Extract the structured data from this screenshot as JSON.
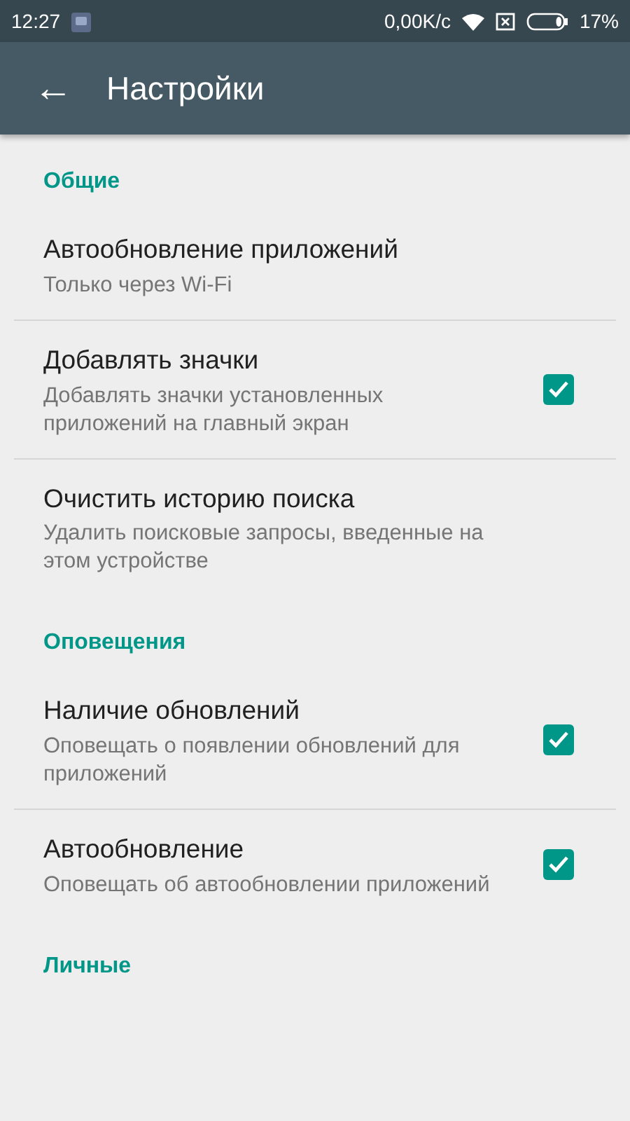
{
  "status_bar": {
    "time": "12:27",
    "speed": "0,00K/c",
    "battery": "17%"
  },
  "toolbar": {
    "back": "←",
    "title": "Настройки"
  },
  "sections": [
    {
      "title": "Общие",
      "items": [
        {
          "kind": "plain",
          "title": "Автообновление приложений",
          "summary": "Только через Wi-Fi"
        },
        {
          "kind": "checkbox",
          "title": "Добавлять значки",
          "summary": "Добавлять значки установленных приложений на главный экран",
          "checked": true
        },
        {
          "kind": "plain",
          "title": "Очистить историю поиска",
          "summary": "Удалить поисковые запросы, введенные на этом устройстве"
        }
      ]
    },
    {
      "title": "Оповещения",
      "items": [
        {
          "kind": "checkbox",
          "title": "Наличие обновлений",
          "summary": "Оповещать о появлении обновлений для приложений",
          "checked": true
        },
        {
          "kind": "checkbox",
          "title": "Автообновление",
          "summary": "Оповещать об автообновлении приложений",
          "checked": true
        }
      ]
    },
    {
      "title": "Личные"
    }
  ]
}
